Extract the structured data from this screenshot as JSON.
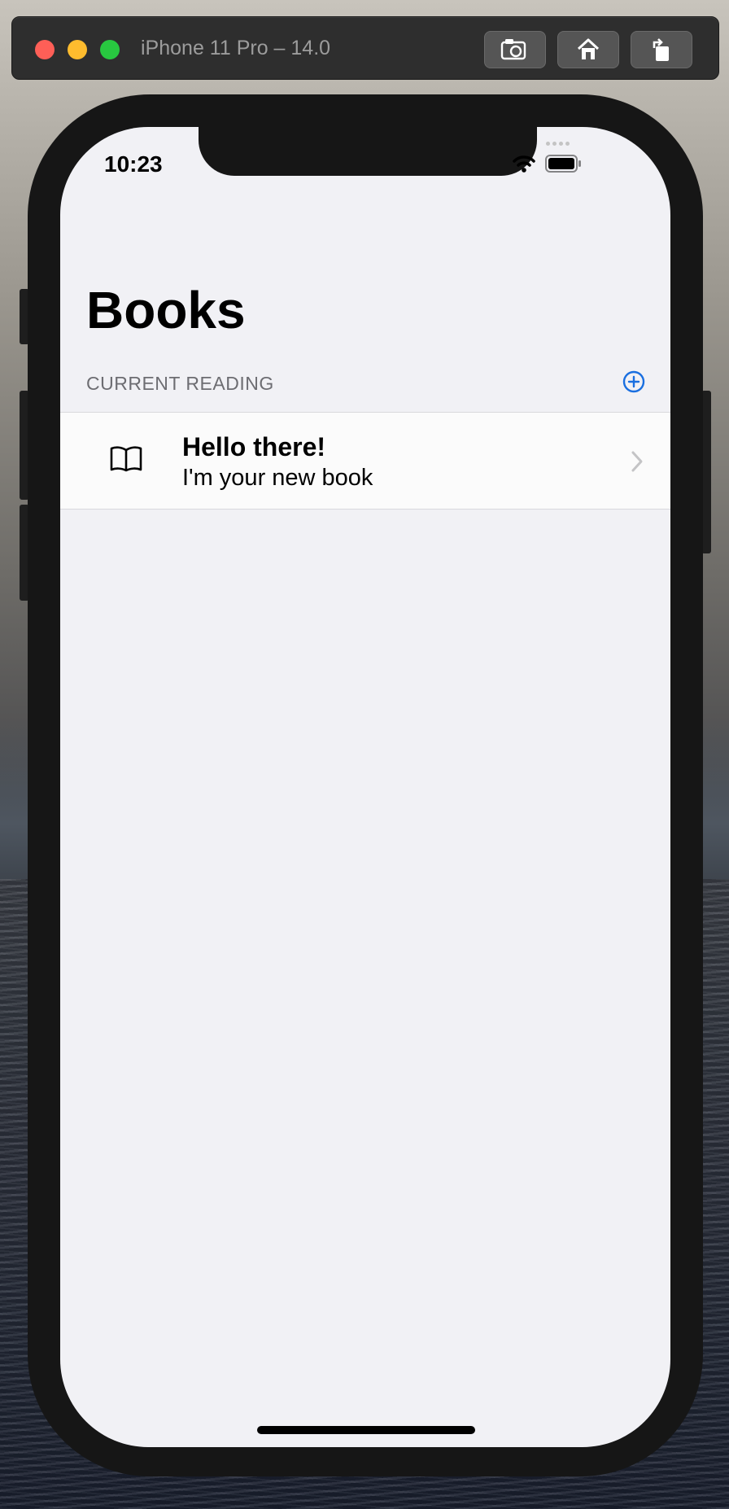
{
  "simulator": {
    "title": "iPhone 11 Pro – 14.0",
    "buttons": [
      "screenshot-icon",
      "home-icon",
      "rotate-icon"
    ]
  },
  "status_bar": {
    "time": "10:23",
    "icons": [
      "signal-dots-icon",
      "wifi-icon",
      "battery-icon"
    ]
  },
  "nav": {
    "large_title": "Books"
  },
  "section": {
    "header": "CURRENT READING",
    "add_icon": "plus-circle-icon",
    "accent": "#1a6fe0"
  },
  "books": [
    {
      "icon": "book-icon",
      "title": "Hello there!",
      "subtitle": "I'm your new book"
    }
  ]
}
